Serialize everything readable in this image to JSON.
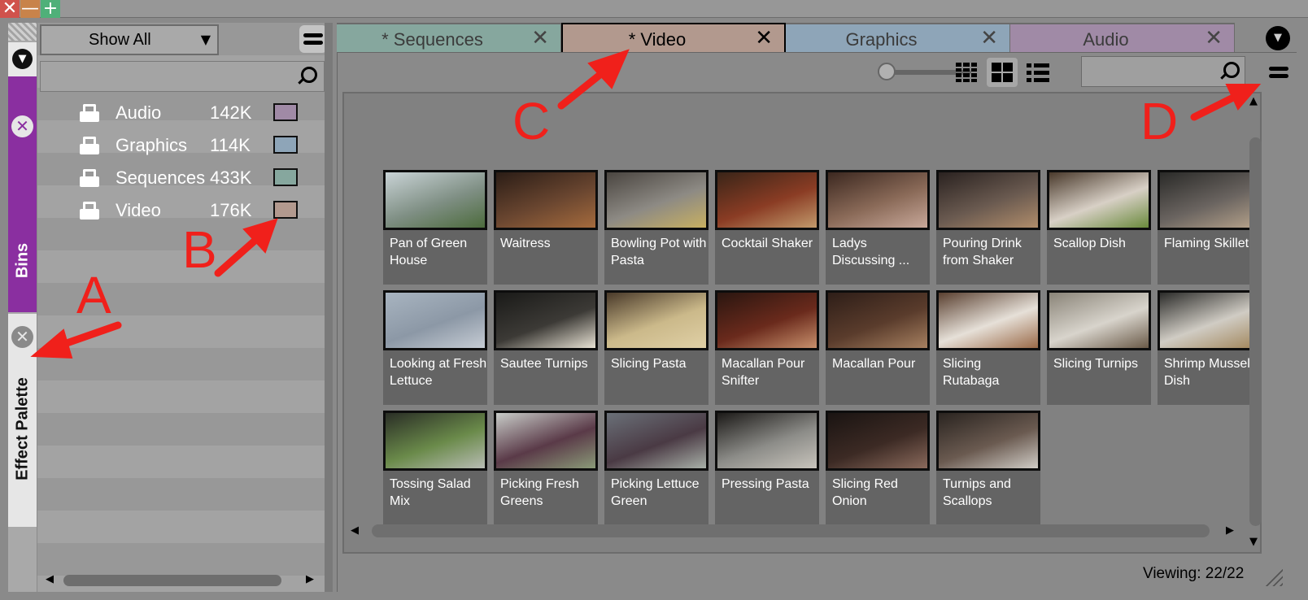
{
  "window": {
    "close_glyph": "✕",
    "minimize_glyph": "—",
    "maximize_glyph": "+"
  },
  "left_strip": {
    "menu_glyph": "▼",
    "bins_tab_label": "Bins",
    "bins_close_glyph": "✕",
    "effect_palette_label": "Effect Palette",
    "effect_close_glyph": "✕"
  },
  "bins": {
    "filter_value": "Show All",
    "filter_arrow": "▼",
    "search_placeholder": "",
    "items": [
      {
        "name": "Audio",
        "size": "142K",
        "color": "#a08aa6"
      },
      {
        "name": "Graphics",
        "size": "114K",
        "color": "#8ea5b8"
      },
      {
        "name": "Sequences",
        "size": "433K",
        "color": "#86a79e"
      },
      {
        "name": "Video",
        "size": "176K",
        "color": "#b2998e"
      }
    ]
  },
  "tabs": [
    {
      "label": "* Sequences",
      "close": "✕",
      "color": "#86a79e",
      "active": false
    },
    {
      "label": "* Video",
      "close": "✕",
      "color": "#b2998e",
      "active": true
    },
    {
      "label": "Graphics",
      "close": "✕",
      "color": "#8ea5b8",
      "active": false
    },
    {
      "label": "Audio",
      "close": "✕",
      "color": "#a08aa6",
      "active": false
    }
  ],
  "tabs_menu_glyph": "▼",
  "toolbar": {
    "search_placeholder": "",
    "view_modes": [
      "detail-view",
      "thumbnail-view",
      "list-view"
    ],
    "selected_view": "thumbnail-view"
  },
  "clips": [
    {
      "name": "Pan of Green House",
      "colors": [
        "#c9d3d6",
        "#7f8f84",
        "#4c6b3c"
      ]
    },
    {
      "name": "Waitress",
      "colors": [
        "#2b1d16",
        "#6a4630",
        "#a56b3d"
      ]
    },
    {
      "name": "Bowling Pot with Pasta",
      "colors": [
        "#4a4540",
        "#8d8a84",
        "#c8b061"
      ]
    },
    {
      "name": "Cocktail Shaker",
      "colors": [
        "#3a2518",
        "#8a3c24",
        "#c29a6c"
      ]
    },
    {
      "name": "Ladys Discussing ...",
      "colors": [
        "#3c2820",
        "#8a6a58",
        "#c8a89a"
      ]
    },
    {
      "name": "Pouring Drink from Shaker",
      "colors": [
        "#2a2220",
        "#6a5a50",
        "#b08d6b"
      ]
    },
    {
      "name": "Scallop Dish",
      "colors": [
        "#4a3a2c",
        "#d8d0c6",
        "#6a8a3c"
      ]
    },
    {
      "name": "Flaming Skillet",
      "colors": [
        "#2a2a28",
        "#6a6460",
        "#b8a48c"
      ]
    },
    {
      "name": "Looking at Fresh Lettuce",
      "colors": [
        "#a8b4c0",
        "#8c98a6",
        "#c6ccd4"
      ]
    },
    {
      "name": "Sautee Turnips",
      "colors": [
        "#1a1a18",
        "#3c3a36",
        "#e8e2d4"
      ]
    },
    {
      "name": "Slicing Pasta",
      "colors": [
        "#4a3a2a",
        "#cbb98a",
        "#e0d0a6"
      ]
    },
    {
      "name": "Macallan Pour Snifter",
      "colors": [
        "#2a1610",
        "#6a2a1c",
        "#c8906c"
      ]
    },
    {
      "name": "Macallan Pour",
      "colors": [
        "#2e1e18",
        "#5a3c2c",
        "#a68060"
      ]
    },
    {
      "name": "Slicing Rutabaga",
      "colors": [
        "#5a4030",
        "#e6e0d8",
        "#9a6a48"
      ]
    },
    {
      "name": "Slicing Turnips",
      "colors": [
        "#8a8478",
        "#d8d4cc",
        "#6a5a48"
      ]
    },
    {
      "name": "Shrimp Mussels Dish",
      "colors": [
        "#2c2c2a",
        "#d0ccc4",
        "#a08458"
      ]
    },
    {
      "name": "Tossing Salad Mix",
      "colors": [
        "#2a2e26",
        "#6a8a4a",
        "#b8bcb4"
      ]
    },
    {
      "name": "Picking Fresh Greens",
      "colors": [
        "#c8ccc8",
        "#5a3a48",
        "#8a9a78"
      ]
    },
    {
      "name": "Picking Lettuce Green",
      "colors": [
        "#6a7078",
        "#4a3a44",
        "#a8b0a8"
      ]
    },
    {
      "name": "Pressing Pasta",
      "colors": [
        "#1c1a18",
        "#8c8c88",
        "#c8c4bc"
      ]
    },
    {
      "name": "Slicing Red Onion",
      "colors": [
        "#1a1412",
        "#3c2a24",
        "#8a6a5c"
      ]
    },
    {
      "name": "Turnips and Scallops",
      "colors": [
        "#2a2420",
        "#6a5a50",
        "#d0ccc6"
      ]
    }
  ],
  "status": {
    "viewing": "Viewing: 22/22"
  },
  "annotations": {
    "a": "A",
    "b": "B",
    "c": "C",
    "d": "D",
    "color": "#f0201b"
  }
}
